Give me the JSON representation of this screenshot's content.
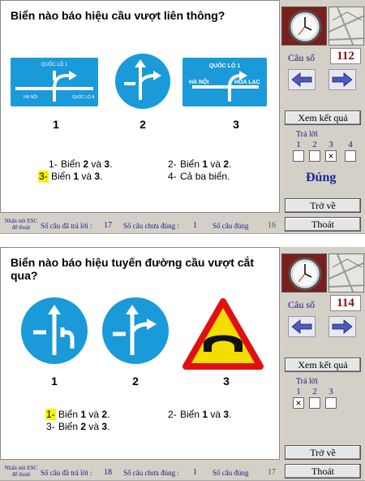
{
  "colors": {
    "sign_blue": "#1a9ad8",
    "warning_yellow": "#f5dd00",
    "warning_red": "#e01010",
    "highlight": "#f6f200",
    "result_blue": "#1a2a9a"
  },
  "sidebar": {
    "cau_so_label": "Câu số",
    "xem_ket_qua": "Xem kết quả",
    "tra_loi_label": "Trả lời",
    "tro_ve": "Trở về",
    "thoat": "Thoát"
  },
  "status": {
    "help_line1": "Nhấn nút ESC",
    "help_line2": "để thoát",
    "answered_label": "Số câu đã trả lời :",
    "unanswered_label": "Số câu chưa đúng :",
    "correct_label": "Số câu đúng"
  },
  "screens": [
    {
      "question": "Biển nào báo hiệu cầu vượt liên thông?",
      "sign_numbers": [
        "1",
        "2",
        "3"
      ],
      "sign1_texts": {
        "top": "QUỐC LỘ 1",
        "left": "HÀ NỘI",
        "right": "QUỐC LỘ 8"
      },
      "sign3_texts": {
        "top": "QUỐC LỘ 1",
        "left": "HÀ NỘI",
        "right": "HÒA LẠC"
      },
      "answers": [
        {
          "num": "1-",
          "text": "Biển 2 và 3."
        },
        {
          "num": "2-",
          "text": "Biển 1 và 2."
        },
        {
          "num": "3-",
          "text": "Biển 1 và 3."
        },
        {
          "num": "4-",
          "text": "Cả ba biển."
        }
      ],
      "question_number": "112",
      "options": [
        "1",
        "2",
        "3",
        "4"
      ],
      "checked": [
        "",
        "",
        "×",
        ""
      ],
      "result": "Đúng",
      "answered": "17",
      "unanswered": "1",
      "correct": "16"
    },
    {
      "question": "Biển nào báo hiệu tuyến đường cầu vượt cắt qua?",
      "sign_numbers": [
        "1",
        "2",
        "3"
      ],
      "answers": [
        {
          "num": "1-",
          "text": "Biển 1 và 2."
        },
        {
          "num": "2-",
          "text": "Biển 1 và 3."
        },
        {
          "num": "3-",
          "text": "Biển 2 và 3."
        }
      ],
      "question_number": "114",
      "options": [
        "1",
        "2",
        "3"
      ],
      "checked": [
        "×",
        "",
        ""
      ],
      "answered": "18",
      "unanswered": "1",
      "correct": "17"
    }
  ]
}
